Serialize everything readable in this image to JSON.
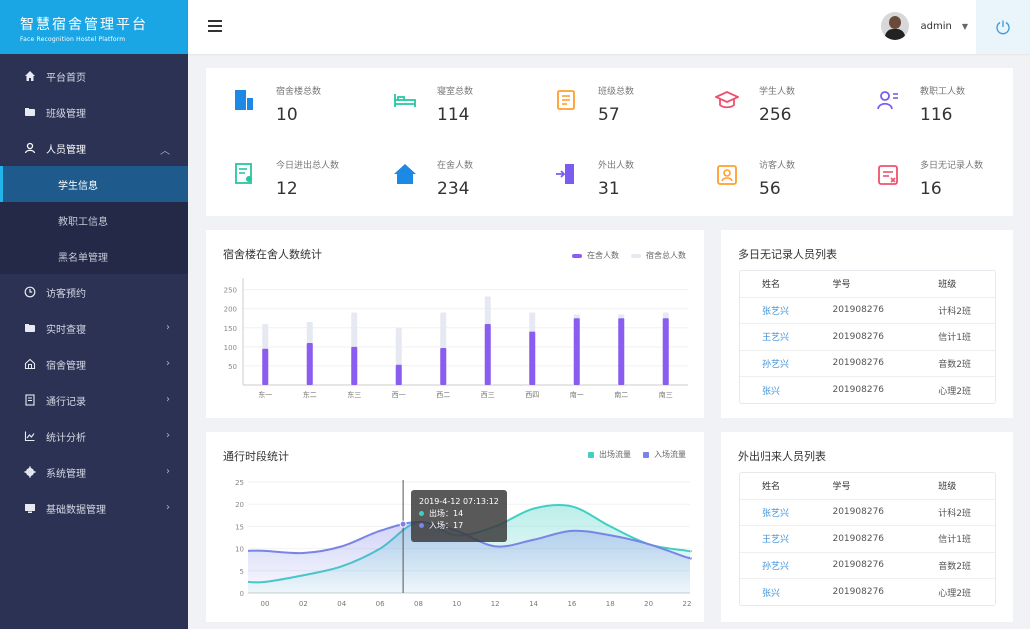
{
  "brand": {
    "title": "智慧宿舍管理平台",
    "subtitle": "Face Recognition Hostel Platform"
  },
  "header": {
    "username": "admin"
  },
  "sidebar": {
    "items": [
      {
        "label": "平台首页",
        "icon": "home-icon"
      },
      {
        "label": "班级管理",
        "icon": "folder-icon"
      },
      {
        "label": "人员管理",
        "icon": "person-icon"
      },
      {
        "label": "访客预约",
        "icon": "clock-icon"
      },
      {
        "label": "实时查寝",
        "icon": "folder-icon"
      },
      {
        "label": "宿舍管理",
        "icon": "house-icon"
      },
      {
        "label": "通行记录",
        "icon": "record-icon"
      },
      {
        "label": "统计分析",
        "icon": "chart-icon"
      },
      {
        "label": "系统管理",
        "icon": "gear-icon"
      },
      {
        "label": "基础数据管理",
        "icon": "monitor-icon"
      }
    ],
    "subitems": [
      {
        "label": "学生信息"
      },
      {
        "label": "教职工信息"
      },
      {
        "label": "黑名单管理"
      }
    ]
  },
  "stats": [
    {
      "label": "宿舍楼总数",
      "value": "10",
      "color": "#1e88e5",
      "icon": "building-icon"
    },
    {
      "label": "寝室总数",
      "value": "114",
      "color": "#26c6a0",
      "icon": "bed-icon"
    },
    {
      "label": "班级总数",
      "value": "57",
      "color": "#ff9f2e",
      "icon": "book-icon"
    },
    {
      "label": "学生人数",
      "value": "256",
      "color": "#f0506e",
      "icon": "graduation-cap-icon"
    },
    {
      "label": "教职工人数",
      "value": "116",
      "color": "#7b5cf0",
      "icon": "staff-icon"
    },
    {
      "label": "今日进出总人数",
      "value": "12",
      "color": "#26c6a0",
      "icon": "report-icon"
    },
    {
      "label": "在舍人数",
      "value": "234",
      "color": "#1e88e5",
      "icon": "home-filled-icon"
    },
    {
      "label": "外出人数",
      "value": "31",
      "color": "#7b5cf0",
      "icon": "door-exit-icon"
    },
    {
      "label": "访客人数",
      "value": "56",
      "color": "#ff9f2e",
      "icon": "visitor-icon"
    },
    {
      "label": "多日无记录人数",
      "value": "16",
      "color": "#f0506e",
      "icon": "calendar-x-icon"
    }
  ],
  "bar_panel": {
    "title": "宿舍楼在舍人数统计"
  },
  "line_panel": {
    "title": "通行时段统计"
  },
  "tooltip": {
    "title": "2019-4-12 07:13:12",
    "line1": "出场：14",
    "line2": "入场：17"
  },
  "chart_data": [
    {
      "type": "bar",
      "categories": [
        "东一",
        "东二",
        "东三",
        "西一",
        "西二",
        "西三",
        "西四",
        "南一",
        "南二",
        "南三"
      ],
      "series": [
        {
          "name": "在舍人数",
          "values": [
            95,
            110,
            100,
            53,
            97,
            160,
            140,
            175,
            175,
            175
          ],
          "color": "#8a5cf0"
        },
        {
          "name": "宿舍总人数",
          "values": [
            160,
            165,
            190,
            150,
            190,
            232,
            190,
            185,
            185,
            190
          ],
          "color": "#e6e9f2"
        }
      ],
      "yticks": [
        50,
        100,
        150,
        200,
        250
      ],
      "ylim": [
        0,
        270
      ]
    },
    {
      "type": "area",
      "x": [
        "00",
        "02",
        "04",
        "06",
        "08",
        "10",
        "12",
        "14",
        "16",
        "18",
        "20",
        "22"
      ],
      "series": [
        {
          "name": "出场流量",
          "values": [
            2.5,
            4,
            6,
            10,
            16,
            13,
            15,
            19,
            19.5,
            15,
            11,
            9.5
          ],
          "color": "#40cfc3"
        },
        {
          "name": "入场流量",
          "values": [
            9.5,
            9,
            10.5,
            14,
            16,
            14,
            10.5,
            12,
            14,
            13,
            11,
            8
          ],
          "color": "#7a83e6"
        }
      ],
      "yticks": [
        0,
        5,
        10,
        15,
        20,
        25
      ],
      "ylim": [
        0,
        25
      ]
    }
  ],
  "table_norecord": {
    "title": "多日无记录人员列表",
    "headers": [
      "姓名",
      "学号",
      "班级"
    ],
    "rows": [
      [
        "张艺兴",
        "201908276",
        "计科2班"
      ],
      [
        "王艺兴",
        "201908276",
        "信计1班"
      ],
      [
        "孙艺兴",
        "201908276",
        "音数2班"
      ],
      [
        "张兴",
        "201908276",
        "心理2班"
      ]
    ]
  },
  "table_return": {
    "title": "外出归来人员列表",
    "headers": [
      "姓名",
      "学号",
      "班级"
    ],
    "rows": [
      [
        "张艺兴",
        "201908276",
        "计科2班"
      ],
      [
        "王艺兴",
        "201908276",
        "信计1班"
      ],
      [
        "孙艺兴",
        "201908276",
        "音数2班"
      ],
      [
        "张兴",
        "201908276",
        "心理2班"
      ]
    ]
  }
}
